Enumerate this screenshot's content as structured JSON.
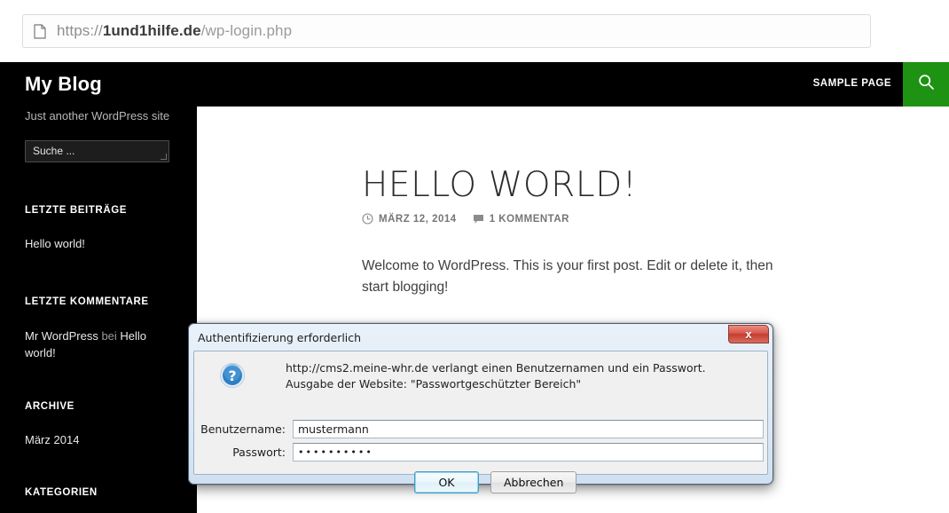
{
  "browser": {
    "url_scheme": "https://",
    "url_domain": "1und1hilfe.de",
    "url_path": "/wp-login.php",
    "page_icon": "page-icon"
  },
  "site": {
    "title": "My Blog",
    "tagline": "Just another WordPress site",
    "nav_link": "SAMPLE PAGE",
    "search_icon": "search-icon",
    "accent_color": "#1e9212",
    "search_placeholder": "Suche ...",
    "widgets": {
      "recent_posts_title": "LETZTE BEITRÄGE",
      "recent_posts_items": [
        "Hello world!"
      ],
      "recent_comments_title": "LETZTE KOMMENTARE",
      "recent_comments_author": "Mr WordPress",
      "recent_comments_mid": " bei ",
      "recent_comments_post": "Hello world!",
      "archives_title": "ARCHIVE",
      "archives_items": [
        "März 2014"
      ],
      "categories_title": "KATEGORIEN"
    }
  },
  "post": {
    "title": "Hello world!",
    "date": "MÄRZ 12, 2014",
    "comments": "1 KOMMENTAR",
    "date_icon": "clock-icon",
    "comment_icon": "comment-icon",
    "body": "Welcome to WordPress. This is your first post. Edit or delete it, then start blogging!"
  },
  "dialog": {
    "title": "Authentifizierung erforderlich",
    "close_label": "x",
    "help_icon": "help-question-icon",
    "message": "http://cms2.meine-whr.de verlangt einen Benutzernamen und ein Passwort. Ausgabe der Website: \"Passwortgeschützter Bereich\"",
    "username_label": "Benutzername:",
    "username_value": "mustermann",
    "password_label": "Passwort:",
    "password_value": "••••••••••",
    "ok_label": "OK",
    "cancel_label": "Abbrechen"
  }
}
